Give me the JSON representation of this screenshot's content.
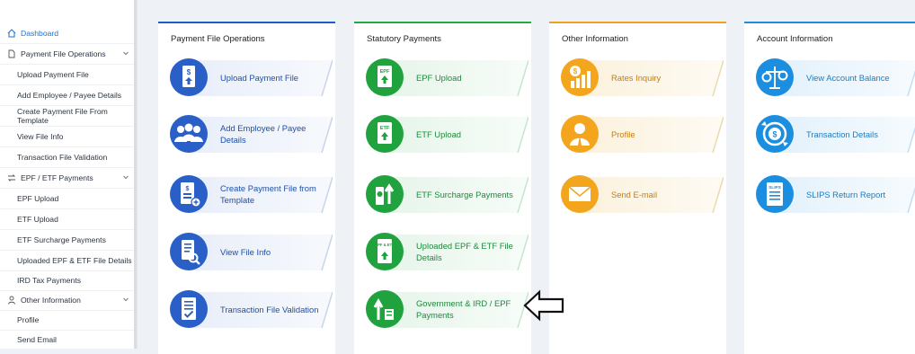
{
  "sidebar": {
    "items": [
      {
        "label": "Dashboard",
        "icon": "home-icon"
      },
      {
        "label": "Payment File Operations",
        "icon": "file-icon"
      },
      {
        "label": "Upload Payment File"
      },
      {
        "label": "Add Employee / Payee Details"
      },
      {
        "label": "Create Payment File From Template"
      },
      {
        "label": "View File Info"
      },
      {
        "label": "Transaction File Validation"
      },
      {
        "label": "EPF / ETF Payments",
        "icon": "transfer-icon"
      },
      {
        "label": "EPF Upload"
      },
      {
        "label": "ETF Upload"
      },
      {
        "label": "ETF Surcharge Payments"
      },
      {
        "label": "Uploaded EPF & ETF File Details"
      },
      {
        "label": "IRD Tax Payments"
      },
      {
        "label": "Other Information",
        "icon": "person-icon"
      },
      {
        "label": "Profile"
      },
      {
        "label": "Send Email"
      }
    ]
  },
  "panels": [
    {
      "title": "Payment File Operations",
      "accent": "#1f5fc4",
      "tiles": [
        {
          "label": "Upload Payment File",
          "icon": "upload-file-icon"
        },
        {
          "label": "Add Employee / Payee Details",
          "icon": "people-group-icon"
        },
        {
          "label": "Create Payment File from Template",
          "icon": "template-file-icon"
        },
        {
          "label": "View File Info",
          "icon": "view-file-icon"
        },
        {
          "label": "Transaction File Validation",
          "icon": "validation-icon"
        }
      ]
    },
    {
      "title": "Statutory Payments",
      "accent": "#23a84a",
      "tiles": [
        {
          "label": "EPF Upload",
          "icon": "epf-upload-icon",
          "badge": "EPF"
        },
        {
          "label": "ETF Upload",
          "icon": "etf-upload-icon",
          "badge": "ETF"
        },
        {
          "label": "ETF Surcharge Payments",
          "icon": "surcharge-icon"
        },
        {
          "label": "Uploaded EPF & ETF File Details",
          "icon": "epf-etf-file-icon",
          "badge": "EPF & ETF"
        },
        {
          "label": "Government & IRD / EPF Payments",
          "icon": "government-payment-icon"
        }
      ]
    },
    {
      "title": "Other Information",
      "accent": "#f0a020",
      "tiles": [
        {
          "label": "Rates Inquiry",
          "icon": "rates-icon"
        },
        {
          "label": "Profile",
          "icon": "profile-icon"
        },
        {
          "label": "Send E-mail",
          "icon": "email-icon"
        }
      ]
    },
    {
      "title": "Account Information",
      "accent": "#1e8fd8",
      "tiles": [
        {
          "label": "View Account Balance",
          "icon": "balance-scale-icon"
        },
        {
          "label": "Transaction Details",
          "icon": "transaction-icon"
        },
        {
          "label": "SLIPS Return Report",
          "icon": "report-icon",
          "badge": "SLIPS"
        }
      ]
    }
  ]
}
